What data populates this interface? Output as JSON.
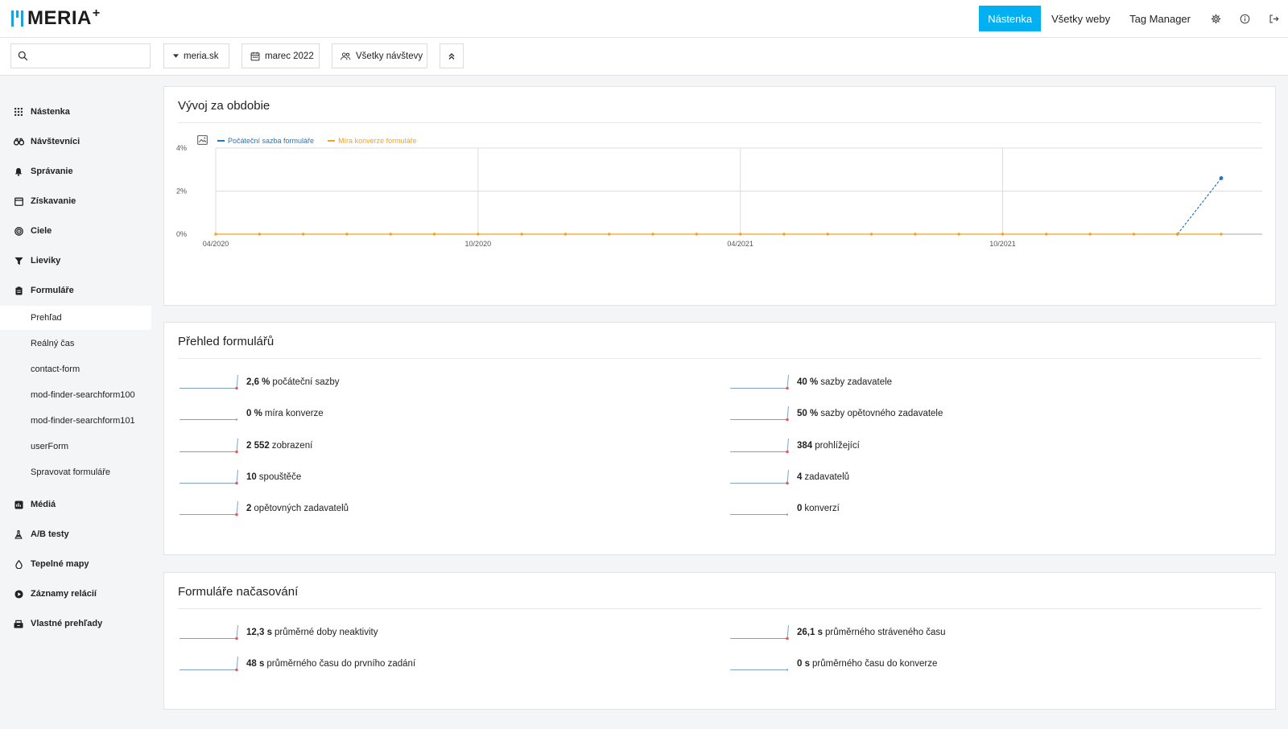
{
  "brand": {
    "name": "MERIA",
    "suffix": "+"
  },
  "topnav": {
    "dashboard": "Nástenka",
    "all_sites": "Všetky weby",
    "tag_manager": "Tag Manager"
  },
  "filters": {
    "search_placeholder": "",
    "site": "meria.sk",
    "period": "marec 2022",
    "segment": "Všetky návštevy"
  },
  "sidebar": {
    "items": [
      {
        "label": "Nástenka",
        "icon": "grid-icon"
      },
      {
        "label": "Návštevníci",
        "icon": "binoculars-icon"
      },
      {
        "label": "Správanie",
        "icon": "bell-icon"
      },
      {
        "label": "Získavanie",
        "icon": "calendar-icon"
      },
      {
        "label": "Ciele",
        "icon": "target-icon"
      },
      {
        "label": "Lieviky",
        "icon": "funnel-icon"
      },
      {
        "label": "Formuláře",
        "icon": "clipboard-icon"
      },
      {
        "label": "Médiá",
        "icon": "media-icon"
      },
      {
        "label": "A/B testy",
        "icon": "flask-icon"
      },
      {
        "label": "Tepelné mapy",
        "icon": "drop-icon"
      },
      {
        "label": "Záznamy relácií",
        "icon": "play-icon"
      },
      {
        "label": "Vlastné prehľady",
        "icon": "report-icon"
      }
    ],
    "subitems": [
      {
        "label": "Prehľad"
      },
      {
        "label": "Reálný čas"
      },
      {
        "label": "contact-form"
      },
      {
        "label": "mod-finder-searchform100"
      },
      {
        "label": "mod-finder-searchform101"
      },
      {
        "label": "userForm"
      },
      {
        "label": "Spravovat formuláře"
      }
    ]
  },
  "evolution": {
    "title": "Vývoj za obdobie"
  },
  "chart_data": {
    "type": "line",
    "title": "",
    "xlabel": "",
    "ylabel": "",
    "x_tick_labels": [
      "04/2020",
      "10/2020",
      "04/2021",
      "10/2021"
    ],
    "y_tick_labels": [
      "4%",
      "2%",
      "0%"
    ],
    "ylim": [
      0,
      4
    ],
    "x": [
      "04/2020",
      "05/2020",
      "06/2020",
      "07/2020",
      "08/2020",
      "09/2020",
      "10/2020",
      "11/2020",
      "12/2020",
      "01/2021",
      "02/2021",
      "03/2021",
      "04/2021",
      "05/2021",
      "06/2021",
      "07/2021",
      "08/2021",
      "09/2021",
      "10/2021",
      "11/2021",
      "12/2021",
      "01/2022",
      "02/2022",
      "03/2022"
    ],
    "series": [
      {
        "name": "Počáteční sazba formuláře",
        "color": "#1f77c4",
        "values": [
          null,
          null,
          null,
          null,
          null,
          null,
          null,
          null,
          null,
          null,
          null,
          null,
          null,
          null,
          null,
          null,
          null,
          null,
          null,
          null,
          null,
          null,
          0,
          2.6
        ]
      },
      {
        "name": "Míra konverze formuláře",
        "color": "#f5a21d",
        "values": [
          0,
          0,
          0,
          0,
          0,
          0,
          0,
          0,
          0,
          0,
          0,
          0,
          0,
          0,
          0,
          0,
          0,
          0,
          0,
          0,
          0,
          0,
          0,
          0
        ]
      }
    ],
    "grid": true,
    "legend_position": "top-left"
  },
  "overview": {
    "title": "Přehled formulářů",
    "metrics": [
      {
        "value": "2,6 %",
        "label": "počáteční sazby",
        "trend": "up"
      },
      {
        "value": "40 %",
        "label": "sazby zadavatele",
        "trend": "up"
      },
      {
        "value": "0 %",
        "label": "míra konverze",
        "trend": "flat"
      },
      {
        "value": "50 %",
        "label": "sazby opětovného zadavatele",
        "trend": "up"
      },
      {
        "value": "2 552",
        "label": "zobrazení",
        "trend": "up"
      },
      {
        "value": "384",
        "label": "prohlížející",
        "trend": "up"
      },
      {
        "value": "10",
        "label": "spouštěče",
        "trend": "up"
      },
      {
        "value": "4",
        "label": "zadavatelů",
        "trend": "up"
      },
      {
        "value": "2",
        "label": "opětovných zadavatelů",
        "trend": "up"
      },
      {
        "value": "0",
        "label": "konverzí",
        "trend": "flat"
      }
    ]
  },
  "timing": {
    "title": "Formuláře načasování",
    "metrics": [
      {
        "value": "12,3 s",
        "label": "průměrné doby neaktivity",
        "trend": "up"
      },
      {
        "value": "26,1 s",
        "label": "průměrného stráveného času",
        "trend": "up"
      },
      {
        "value": "48 s",
        "label": "průměrného času do prvního zadání",
        "trend": "up"
      },
      {
        "value": "0 s",
        "label": "průměrného času do konverze",
        "trend": "flat"
      }
    ]
  }
}
